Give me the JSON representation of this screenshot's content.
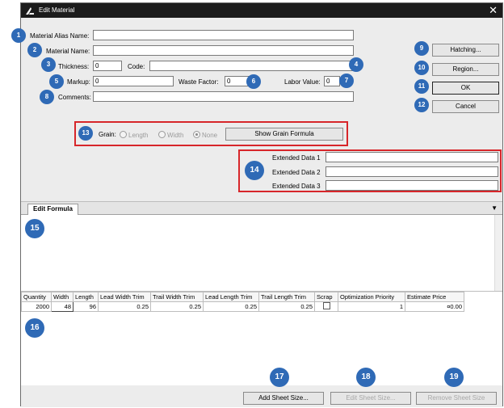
{
  "window": {
    "title": "Edit Material",
    "close_glyph": "✕"
  },
  "fields": {
    "alias_label": "Material Alias Name:",
    "name_label": "Material Name:",
    "thickness_label": "Thickness:",
    "thickness_value": "0",
    "code_label": "Code:",
    "markup_label": "Markup:",
    "markup_value": "0",
    "waste_label": "Waste Factor:",
    "waste_value": "0",
    "labor_label": "Labor Value:",
    "labor_value": "0",
    "comments_label": "Comments:"
  },
  "buttons": {
    "hatching": "Hatching...",
    "region": "Region...",
    "ok": "OK",
    "cancel": "Cancel",
    "show_grain": "Show Grain Formula",
    "add_sheet": "Add Sheet Size...",
    "edit_sheet": "Edit Sheet Size...",
    "remove_sheet": "Remove Sheet Size"
  },
  "grain": {
    "label": "Grain:",
    "options": [
      "Length",
      "Width",
      "None"
    ],
    "selected": "None"
  },
  "extended": {
    "d1": "Extended Data 1",
    "d2": "Extended Data 2",
    "d3": "Extended Data 3"
  },
  "tabs": {
    "edit_formula": "Edit Formula",
    "dropdown_glyph": "▼"
  },
  "sheet_table": {
    "columns": [
      "Quantity",
      "Width",
      "Length",
      "Lead Width Trim",
      "Trail Width Trim",
      "Lead Length Trim",
      "Trail Length Trim",
      "Scrap",
      "Optimization Priority",
      "Estimate Price"
    ],
    "rows": [
      {
        "quantity": "2000",
        "width": "48",
        "length": "96",
        "lead_width_trim": "0.25",
        "trail_width_trim": "0.25",
        "lead_length_trim": "0.25",
        "trail_length_trim": "0.25",
        "scrap": "",
        "priority": "1",
        "price": "¤0.00"
      }
    ]
  },
  "callouts": [
    "1",
    "2",
    "3",
    "4",
    "5",
    "6",
    "7",
    "8",
    "9",
    "10",
    "11",
    "12",
    "13",
    "14",
    "15",
    "16",
    "17",
    "18",
    "19"
  ],
  "colors": {
    "callout": "#2f6ab6",
    "highlight": "#d7262a",
    "titlebar": "#1c1c1c"
  }
}
